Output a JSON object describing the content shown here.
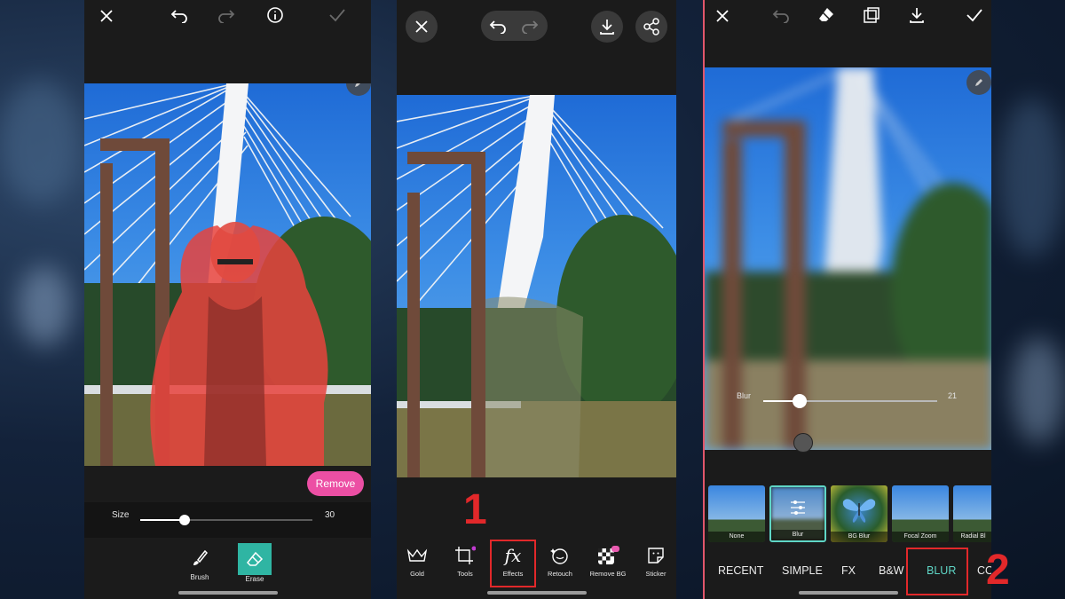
{
  "screens": {
    "erase": {
      "remove_label": "Remove",
      "size_label": "Size",
      "size_value": "30",
      "size_fraction": 0.26,
      "tools": [
        {
          "label": "Brush",
          "icon": "brush-icon",
          "active": false
        },
        {
          "label": "Erase",
          "icon": "eraser-icon",
          "active": true
        }
      ]
    },
    "editor": {
      "tools": [
        {
          "label": "Gold",
          "icon": "crown-icon"
        },
        {
          "label": "Tools",
          "icon": "crop-icon"
        },
        {
          "label": "Effects",
          "icon": "fx-icon"
        },
        {
          "label": "Retouch",
          "icon": "retouch-icon"
        },
        {
          "label": "Remove BG",
          "icon": "checker-icon"
        },
        {
          "label": "Sticker",
          "icon": "sticker-icon"
        }
      ],
      "effects_glyph": "fx"
    },
    "blur": {
      "blur_label": "Blur",
      "blur_value": "21",
      "blur_fraction": 0.21,
      "thumbnails": [
        {
          "label": "None"
        },
        {
          "label": "Blur",
          "selected": true
        },
        {
          "label": "BG Blur"
        },
        {
          "label": "Focal Zoom"
        },
        {
          "label": "Radial Bl"
        }
      ],
      "tabs": [
        "RECENT",
        "SIMPLE",
        "FX",
        "B&W",
        "BLUR",
        "CO"
      ],
      "active_tab": "BLUR"
    }
  },
  "annotations": {
    "step1": "1",
    "step2": "2"
  },
  "colors": {
    "accent_pink": "#ec4fa4",
    "accent_teal": "#2fb5a3",
    "annotation_red": "#e2282a"
  }
}
